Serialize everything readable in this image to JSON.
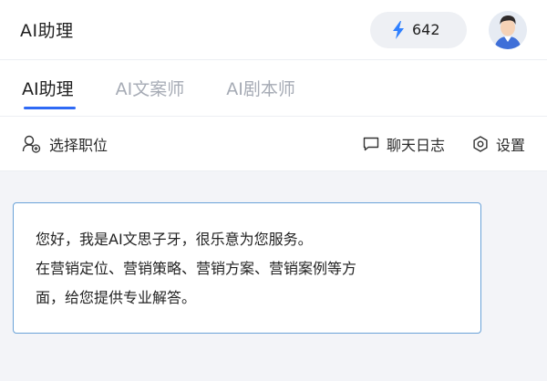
{
  "header": {
    "title": "AI助理",
    "credits": "642"
  },
  "tabs": [
    {
      "label": "AI助理",
      "active": true
    },
    {
      "label": "AI文案师",
      "active": false
    },
    {
      "label": "AI剧本师",
      "active": false
    }
  ],
  "toolbar": {
    "select_role": "选择职位",
    "chat_log": "聊天日志",
    "settings": "设置"
  },
  "message": {
    "line1": "您好，我是AI文思子牙，很乐意为您服务。",
    "line2": "在营销定位、营销策略、营销方案、营销案例等方",
    "line3": "面，给您提供专业解答。"
  },
  "colors": {
    "accent": "#2f6af5",
    "bolt": "#2f80ff",
    "bubble_border": "#6aa2d8"
  },
  "icons": {
    "credits": "lightning-bolt-icon",
    "select_role": "user-add-icon",
    "chat_log": "message-icon",
    "settings": "gear-icon"
  }
}
